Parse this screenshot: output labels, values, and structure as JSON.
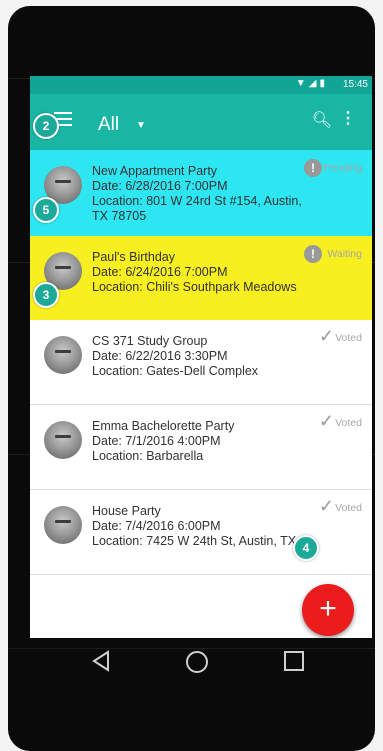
{
  "status_bar": {
    "time": "15:45",
    "icons": "▼◢▮"
  },
  "toolbar": {
    "filter_label": "All"
  },
  "events": [
    {
      "title": "New Appartment Party",
      "date": "Date: 6/28/2016 7:00PM",
      "location": "Location: 801 W 24rd St #154, Austin, TX 78705",
      "status": "Pending",
      "highlight": "#2ee5f2"
    },
    {
      "title": "Paul's Birthday",
      "date": "Date: 6/24/2016 7:00PM",
      "location": "Location: Chili's Southpark Meadows",
      "status": "Waiting",
      "highlight": "#f7ef1f"
    },
    {
      "title": "CS 371 Study Group",
      "date": "Date: 6/22/2016 3:30PM",
      "location": "Location: Gates-Dell Complex",
      "status": "Voted"
    },
    {
      "title": "Emma Bachelorette Party",
      "date": "Date: 7/1/2016 4:00PM",
      "location": "Location: Barbarella",
      "status": "Voted"
    },
    {
      "title": "House Party",
      "date": "Date: 7/4/2016 6:00PM",
      "location": "Location: 7425 W 24th St, Austin, TX",
      "status": "Voted"
    }
  ],
  "badges": {
    "menu": "2",
    "event1": "5",
    "event2": "3",
    "event5": "4"
  },
  "fab": {
    "label": "+"
  },
  "colors": {
    "toolbar": "#19b6a4",
    "status_bar": "#12a596",
    "fab": "#ea1c1c",
    "badge": "#1ba99a"
  }
}
